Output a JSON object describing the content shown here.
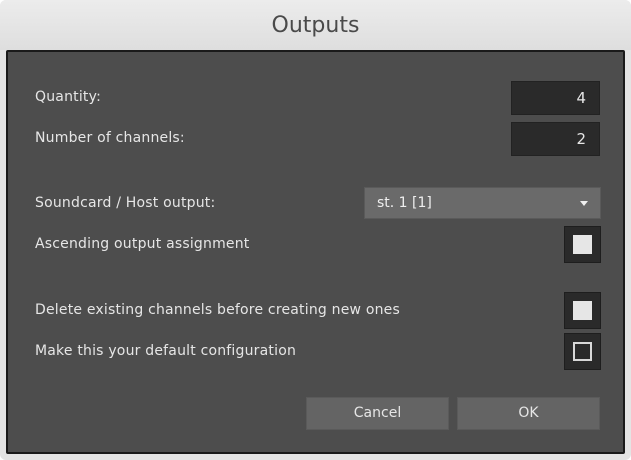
{
  "window": {
    "title": "Outputs"
  },
  "fields": {
    "quantity": {
      "label": "Quantity:",
      "value": "4"
    },
    "channels": {
      "label": "Number of channels:",
      "value": "2"
    }
  },
  "soundcard": {
    "label": "Soundcard / Host output:",
    "selected": "st. 1 [1]",
    "arrow_icon": "triangle-down-icon"
  },
  "options": {
    "ascending": {
      "label": "Ascending output assignment",
      "checked": true
    },
    "delete_existing": {
      "label": "Delete existing channels before creating new ones",
      "checked": true
    },
    "default_config": {
      "label": "Make this your default configuration",
      "checked": false
    }
  },
  "buttons": {
    "cancel": "Cancel",
    "ok": "OK"
  },
  "colors": {
    "panel": "#4d4d4d",
    "field": "#2a2a2a",
    "button": "#646464",
    "text": "#e6e6e6"
  }
}
